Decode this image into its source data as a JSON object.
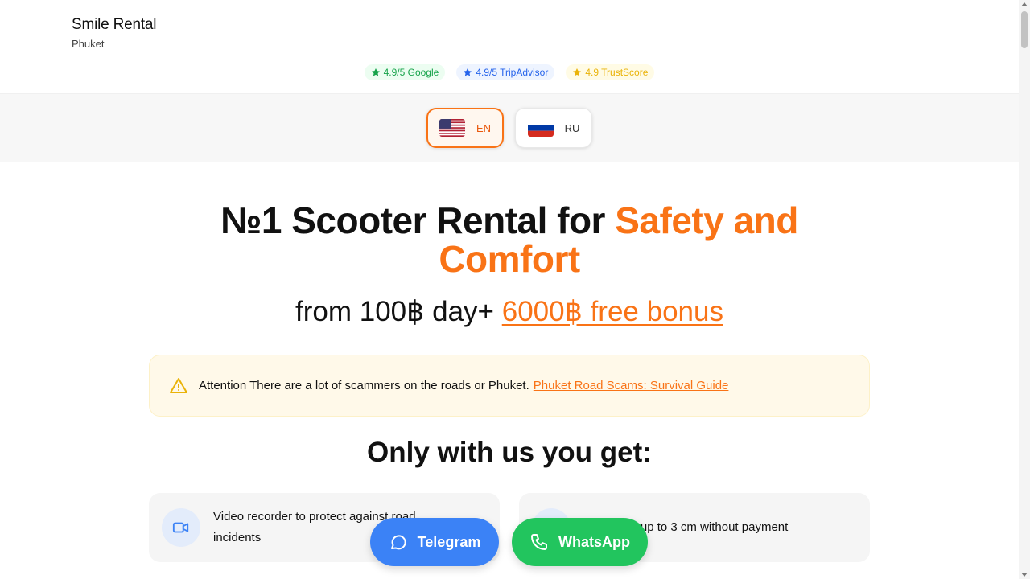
{
  "brand": {
    "name": "Smile Rental",
    "city": "Phuket"
  },
  "ratings": [
    {
      "label": "4.9/5 Google",
      "icon": "star-icon",
      "color": "#16a34a"
    },
    {
      "label": "4.9/5 TripAdvisor",
      "icon": "star-icon",
      "color": "#2563eb"
    },
    {
      "label": "4.9 TrustScore",
      "icon": "star-icon",
      "color": "#eab308"
    }
  ],
  "languages": [
    {
      "code": "EN",
      "flag": "us-flag-icon",
      "active": true
    },
    {
      "code": "RU",
      "flag": "ru-flag-icon",
      "active": false
    }
  ],
  "hero": {
    "title_main": "№1 Scooter Rental for ",
    "title_highlight": "Safety and Comfort",
    "subtitle_main": "from 100฿ day+ ",
    "subtitle_link": "6000฿ free bonus"
  },
  "alert": {
    "icon": "warning-icon",
    "text": "Attention There are a lot of scammers on the roads or Phuket.",
    "link": "Phuket Road Scams: Survival Guide"
  },
  "section": {
    "title": "Only with us you get:"
  },
  "features": [
    {
      "icon": "video-camera-icon",
      "text": "Video recorder to protect against road incidents"
    },
    {
      "icon": "shield-icon",
      "text": "Scratches up to 3 cm without payment"
    }
  ],
  "cta": {
    "telegram": "Telegram",
    "whatsapp": "WhatsApp"
  },
  "colors": {
    "accent": "#f97316",
    "telegram": "#3b82f6",
    "whatsapp": "#22c55e"
  }
}
